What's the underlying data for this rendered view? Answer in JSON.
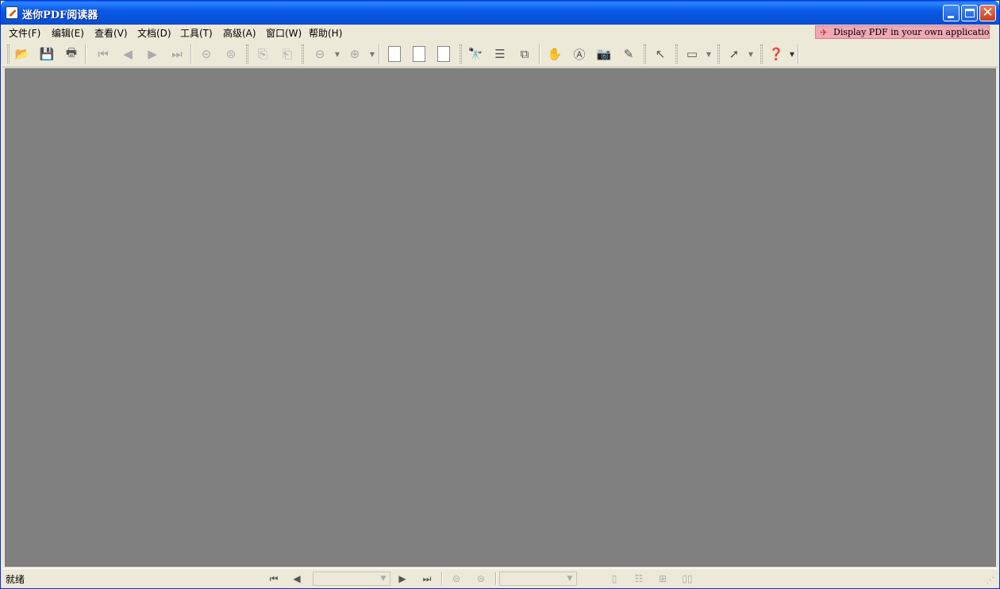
{
  "window": {
    "title": "迷你PDF阅读器",
    "accent": "#0a5ae8",
    "content_bg": "#808080"
  },
  "menu": {
    "items": [
      "文件(F)",
      "编辑(E)",
      "查看(V)",
      "文档(D)",
      "工具(T)",
      "高级(A)",
      "窗口(W)",
      "帮助(H)"
    ],
    "banner": "Display PDF in your own applications"
  },
  "toolbar": {
    "icons": [
      "open-icon",
      "save-icon",
      "print-icon",
      "first-page-icon",
      "prev-page-icon",
      "next-page-icon",
      "last-page-icon",
      "back-icon",
      "forward-icon",
      "rotate-left-icon",
      "rotate-right-icon",
      "zoom-out-icon",
      "zoom-in-icon",
      "actual-size-icon",
      "fit-page-icon",
      "fit-width-icon",
      "find-icon",
      "bookmarks-icon",
      "full-screen-icon",
      "hand-tool-icon",
      "select-text-icon",
      "snapshot-icon",
      "annotation-icon",
      "select-tool-icon",
      "typewriter-icon",
      "arrow-tool-icon",
      "help-icon"
    ]
  },
  "status": {
    "text": "就绪",
    "page_field": "",
    "zoom_field": ""
  }
}
